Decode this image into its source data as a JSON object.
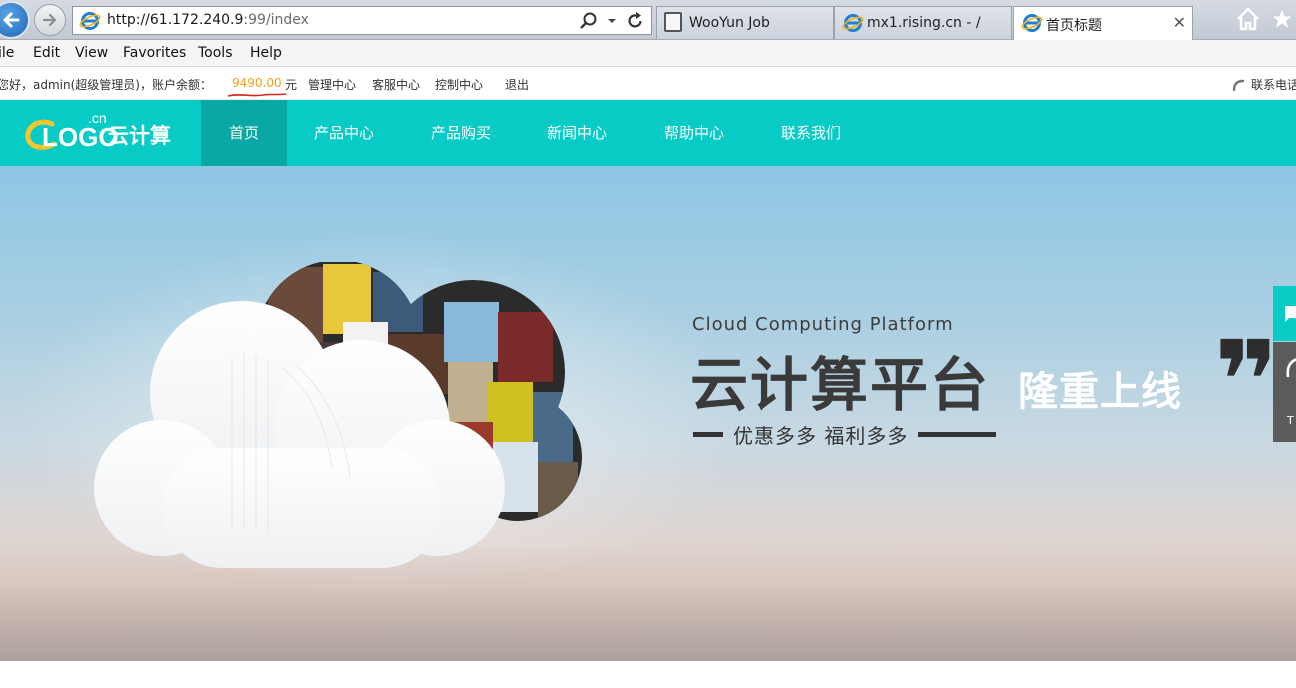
{
  "browser": {
    "address": {
      "host": "http://61.172.240.9",
      "rest": ":99/index"
    },
    "tabs": [
      {
        "label": "WooYun Job",
        "icon": "briefcase-icon",
        "active": false
      },
      {
        "label": "mx1.rising.cn - /",
        "icon": "ie-icon",
        "active": false
      },
      {
        "label": "首页标题",
        "icon": "ie-icon",
        "active": true
      }
    ],
    "menu": [
      "ile",
      "Edit",
      "View",
      "Favorites",
      "Tools",
      "Help"
    ],
    "colors": {
      "back_button": "#1f64b6"
    }
  },
  "site": {
    "topbar": {
      "greeting": "您好，admin(超级管理员)，账户余额：",
      "balance": "9490.00",
      "currency": "元",
      "links": [
        "管理中心",
        "客服中心",
        "控制中心"
      ],
      "logout": "退出",
      "contact": "联系电话"
    },
    "logo": {
      "text": "LOGO",
      "cn": "云计算",
      "suffix": ".cn"
    },
    "nav": [
      "首页",
      "产品中心",
      "产品购买",
      "新闻中心",
      "帮助中心",
      "联系我们"
    ],
    "banner": {
      "en": "Cloud Computing Platform",
      "main": "云计算平台",
      "sub": "隆重上线",
      "tagline": "优惠多多  福利多多"
    },
    "side_button_text": "T",
    "colors": {
      "brand": "#08cbc6",
      "brand_active": "#0aa8a5",
      "balance": "#f5a21a"
    }
  }
}
